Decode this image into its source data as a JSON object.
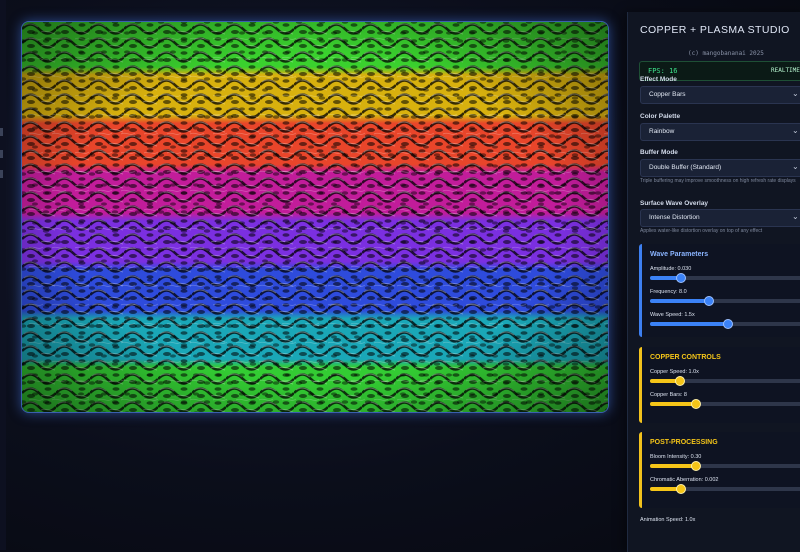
{
  "app": {
    "title": "COPPER + PLASMA STUDIO",
    "subtitle": "(c) mangobananai 2025",
    "fps": "FPS: 16",
    "realtime": "REALTIME"
  },
  "controls": {
    "effect_mode": {
      "label": "Effect Mode",
      "value": "Copper Bars"
    },
    "color_palette": {
      "label": "Color Palette",
      "value": "Rainbow"
    },
    "buffer_mode": {
      "label": "Buffer Mode",
      "value": "Double Buffer (Standard)",
      "hint": "Triple buffering may improve smoothness on high refresh rate displays"
    },
    "surface_wave": {
      "label": "Surface Wave Overlay",
      "value": "Intense Distortion",
      "hint": "Applies water-like distortion overlay on top of any effect"
    }
  },
  "wave": {
    "title": "Wave Parameters",
    "amplitude": {
      "label": "Amplitude: 0.030",
      "fraction": 0.19
    },
    "frequency": {
      "label": "Frequency: 8.0",
      "fraction": 0.36
    },
    "speed": {
      "label": "Wave Speed: 1.5x",
      "fraction": 0.48
    }
  },
  "copper": {
    "title": "COPPER CONTROLS",
    "speed": {
      "label": "Copper Speed: 1.0x",
      "fraction": 0.18
    },
    "bars": {
      "label": "Copper Bars: 8",
      "fraction": 0.28
    }
  },
  "post": {
    "title": "POST-PROCESSING",
    "bloom": {
      "label": "Bloom Intensity: 0.30",
      "fraction": 0.28
    },
    "chromatic": {
      "label": "Chromatic Aberration: 0.002",
      "fraction": 0.19
    }
  },
  "animation_speed": "Animation Speed: 1.0x",
  "colors": {
    "accent_blue": "#3b82f6",
    "accent_gold": "#f5c518",
    "fps_green": "#3ee08a",
    "bands": [
      "#3ad12e",
      "#d8b10e",
      "#e9452a",
      "#c21c9a",
      "#7b2fe0",
      "#2e4bdc",
      "#1aa7b7",
      "#33cc33"
    ]
  }
}
